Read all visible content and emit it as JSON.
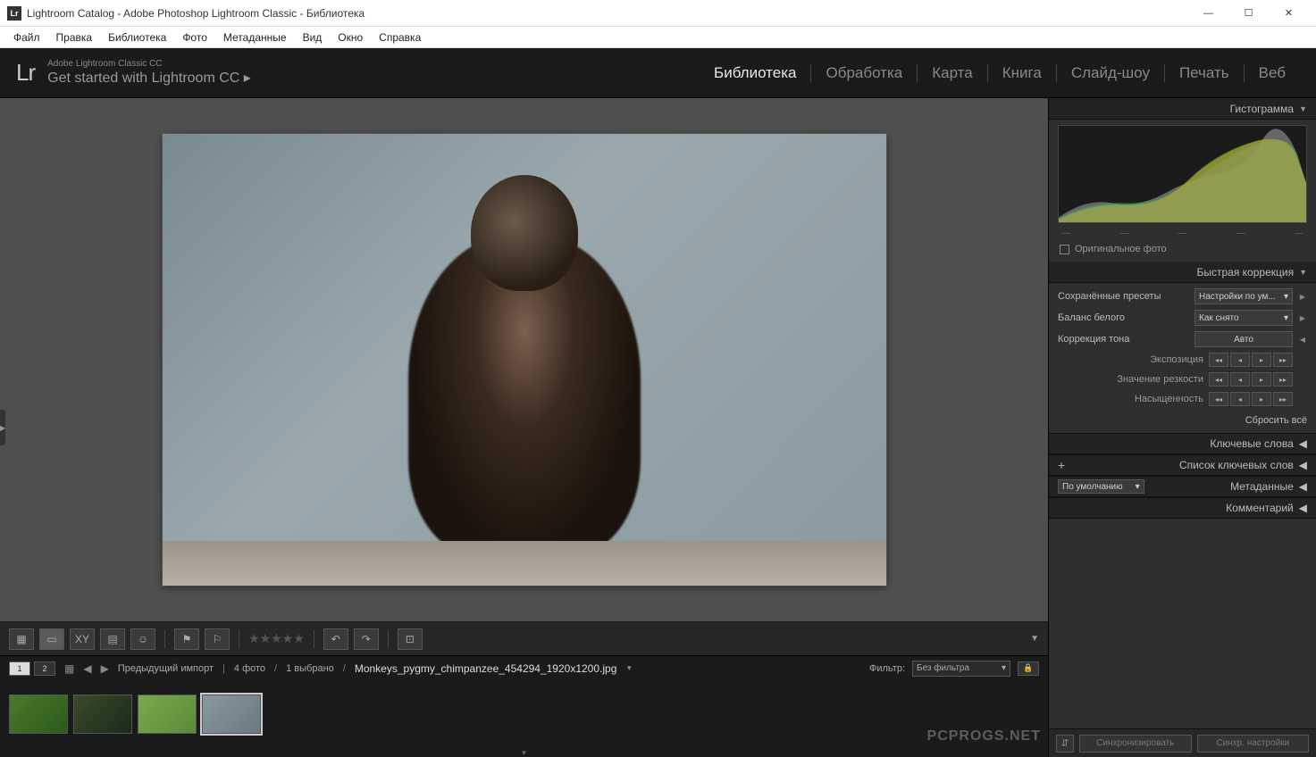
{
  "window": {
    "title": "Lightroom Catalog - Adobe Photoshop Lightroom Classic - Библиотека",
    "app_badge": "Lr"
  },
  "menu": [
    "Файл",
    "Правка",
    "Библиотека",
    "Фото",
    "Метаданные",
    "Вид",
    "Окно",
    "Справка"
  ],
  "brand": {
    "logo": "Lr",
    "line1": "Adobe Lightroom Classic CC",
    "line2": "Get started with Lightroom CC  ▸"
  },
  "modules": {
    "items": [
      "Библиотека",
      "Обработка",
      "Карта",
      "Книга",
      "Слайд-шоу",
      "Печать",
      "Веб"
    ],
    "active": 0
  },
  "right": {
    "histogram": "Гистограмма",
    "original_photo": "Оригинальное фото",
    "quick": {
      "title": "Быстрая коррекция",
      "preset_label": "Сохранённые пресеты",
      "preset_value": "Настройки по ум...",
      "wb_label": "Баланс белого",
      "wb_value": "Как снято",
      "tone_label": "Коррекция тона",
      "auto": "Авто",
      "exposure": "Экспозиция",
      "sharpness": "Значение резкости",
      "saturation": "Насыщенность",
      "reset": "Сбросить всё"
    },
    "keywords": "Ключевые слова",
    "keyword_list": "Список ключевых слов",
    "metadata": "Метаданные",
    "metadata_preset": "По умолчанию",
    "comment": "Комментарий",
    "sync": "Синхронизировать",
    "sync_settings": "Синхр. настройки"
  },
  "filmstrip": {
    "source": "Предыдущий импорт",
    "count": "4 фото",
    "selected": "1 выбрано",
    "filename": "Monkeys_pygmy_chimpanzee_454294_1920x1200.jpg",
    "filter_label": "Фильтр:",
    "filter_value": "Без фильтра",
    "watermark": "PCPROGS.NET"
  }
}
